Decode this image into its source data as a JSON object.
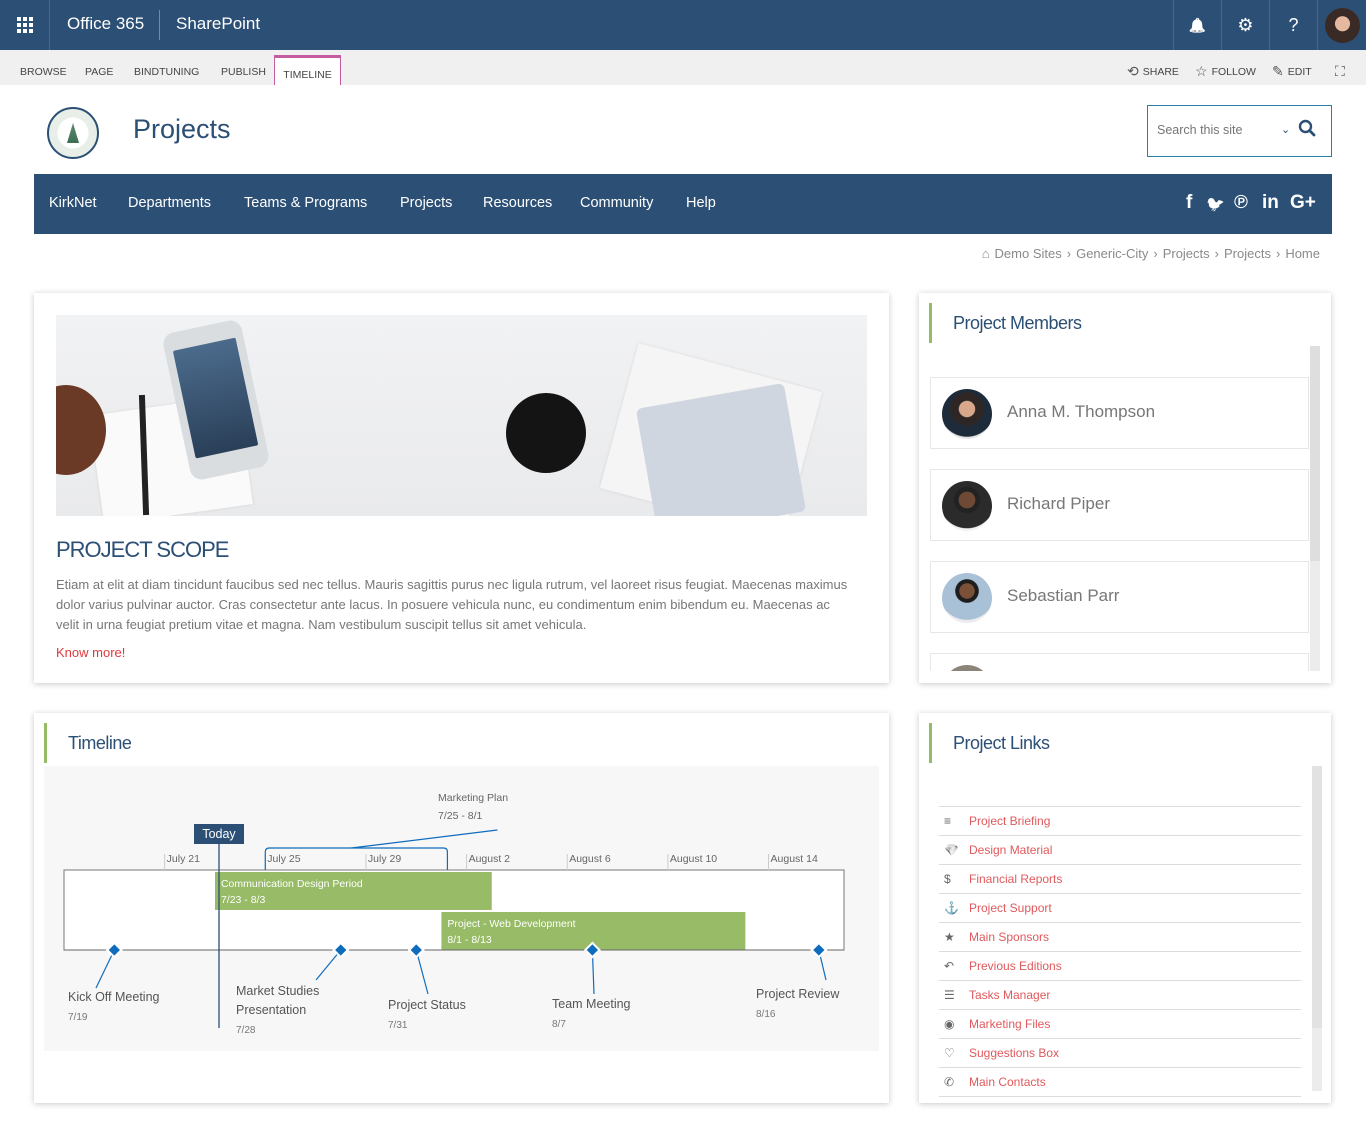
{
  "suitebar": {
    "app_launcher_icon": "waffle-icon",
    "office_label": "Office 365",
    "app_label": "SharePoint",
    "buttons": [
      {
        "name": "notifications",
        "icon": "bell-icon",
        "glyph": "🔔"
      },
      {
        "name": "settings",
        "icon": "gear-icon",
        "glyph": "⚙"
      },
      {
        "name": "help",
        "icon": "question-icon",
        "glyph": "?"
      }
    ]
  },
  "ribbon": {
    "tabs": [
      "BROWSE",
      "PAGE",
      "BINDTUNING",
      "PUBLISH"
    ],
    "active_tab": "TIMELINE",
    "actions": [
      {
        "label": "SHARE",
        "icon": "share-icon",
        "glyph": "⟲"
      },
      {
        "label": "FOLLOW",
        "icon": "star-outline-icon",
        "glyph": "☆"
      },
      {
        "label": "EDIT",
        "icon": "pencil-icon",
        "glyph": "✎"
      }
    ],
    "focus_icon": "⛶"
  },
  "header": {
    "site_title": "Projects",
    "logo_alt": "City of Kirkland Washington",
    "search": {
      "placeholder": "Search this site",
      "value": ""
    }
  },
  "nav": {
    "items": [
      "KirkNet",
      "Departments",
      "Teams & Programs",
      "Projects",
      "Resources",
      "Community",
      "Help"
    ],
    "social": [
      {
        "name": "facebook",
        "glyph": "f"
      },
      {
        "name": "twitter",
        "glyph": "🐦"
      },
      {
        "name": "pinterest",
        "glyph": "℗"
      },
      {
        "name": "linkedin",
        "glyph": "in"
      },
      {
        "name": "google-plus",
        "glyph": "G+"
      }
    ]
  },
  "breadcrumb": {
    "home_icon": "⌂",
    "items": [
      "Demo Sites",
      "Generic-City",
      "Projects",
      "Projects",
      "Home"
    ],
    "separator": "›"
  },
  "scope": {
    "title": "PROJECT SCOPE",
    "body": "Etiam at elit at diam tincidunt faucibus sed nec tellus. Mauris sagittis purus nec ligula rutrum, vel laoreet risus feugiat. Maecenas maximus dolor varius pulvinar auctor. Cras consectetur ante lacus. In posuere vehicula nunc, eu condimentum enim bibendum eu. Maecenas ac velit in urna feugiat pretium vitae et magna. Nam vestibulum suscipit tellus sit amet vehicula.",
    "link_label": "Know more!",
    "link_color": "#e0393e"
  },
  "members": {
    "title": "Project Members",
    "items": [
      {
        "name": "Anna M. Thompson"
      },
      {
        "name": "Richard Piper"
      },
      {
        "name": "Sebastian Parr"
      },
      {
        "name": ""
      }
    ]
  },
  "timeline": {
    "title": "Timeline",
    "today_label": "Today",
    "today_date": "7/24",
    "axis_start": "7/17",
    "axis_end": "8/17",
    "ticks": [
      "July 21",
      "July 25",
      "July 29",
      "August 2",
      "August 6",
      "August 10",
      "August 14"
    ],
    "bars": [
      {
        "title": "Communication Design Period",
        "dates": "7/23 - 8/3"
      },
      {
        "title": "Project - Web Development",
        "dates": "8/1 - 8/13"
      }
    ],
    "callout": {
      "title": "Marketing Plan",
      "dates": "7/25 - 8/1"
    },
    "milestones": [
      {
        "title": "Kick Off Meeting",
        "date": "7/19"
      },
      {
        "title": "Market Studies Presentation",
        "date": "7/28"
      },
      {
        "title": "Project Status",
        "date": "7/31"
      },
      {
        "title": "Team Meeting",
        "date": "8/7"
      },
      {
        "title": "Project Review",
        "date": "8/16"
      }
    ],
    "colors": {
      "bar": "#97bb66",
      "accent": "#0f6cbd",
      "today": "#2c4f75"
    }
  },
  "links": {
    "title": "Project Links",
    "items": [
      {
        "label": "Project Briefing",
        "icon": "menu-icon",
        "glyph": "≡"
      },
      {
        "label": "Design Material",
        "icon": "diamond-icon",
        "glyph": "💎"
      },
      {
        "label": "Financial Reports",
        "icon": "dollar-icon",
        "glyph": "$"
      },
      {
        "label": "Project Support",
        "icon": "anchor-icon",
        "glyph": "⚓"
      },
      {
        "label": "Main Sponsors",
        "icon": "star-icon",
        "glyph": "★"
      },
      {
        "label": "Previous Editions",
        "icon": "reply-all-icon",
        "glyph": "↶"
      },
      {
        "label": "Tasks Manager",
        "icon": "tasks-icon",
        "glyph": "☰"
      },
      {
        "label": "Marketing Files",
        "icon": "target-icon",
        "glyph": "◉"
      },
      {
        "label": "Suggestions Box",
        "icon": "lightbulb-icon",
        "glyph": "♡"
      },
      {
        "label": "Main Contacts",
        "icon": "phone-icon",
        "glyph": "✆"
      }
    ]
  },
  "colors": {
    "brand": "#2c4f75",
    "accent_green": "#94bb65",
    "link_red": "#e0595c",
    "ribbon_active": "#c45ca2"
  }
}
